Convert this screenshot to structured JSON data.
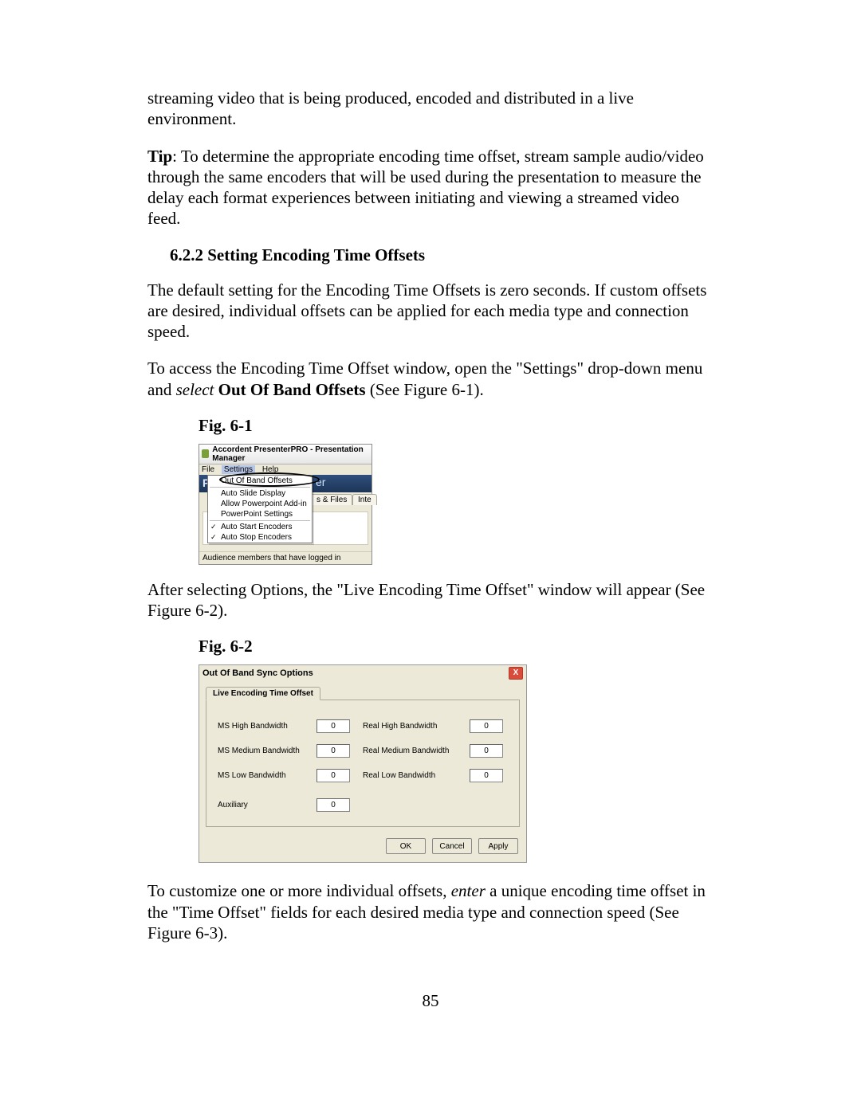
{
  "para1": "streaming video that is being produced, encoded and distributed in a live environment.",
  "tip_label": "Tip",
  "tip_body": ":  To determine the appropriate encoding time offset, stream sample audio/video through the same encoders that will be used during the presentation to measure the delay each format experiences between initiating and viewing a streamed video feed.",
  "heading": "6.2.2  Setting Encoding Time Offsets",
  "para2": "The default setting for the Encoding Time Offsets is zero seconds.  If custom offsets are desired, individual offsets can be applied for each media type and connection speed.",
  "para3a": "To access the Encoding Time Offset window, open the \"Settings\" drop-down menu and ",
  "para3_select": "select",
  "para3_bold": " Out Of Band Offsets",
  "para3b": " (See Figure 6-1).",
  "fig61_cap": "Fig. 6-1",
  "fig61": {
    "title": "Accordent PresenterPRO  - Presentation Manager",
    "menu_file": "File",
    "menu_settings": "Settings",
    "menu_help": "Help",
    "brand_pr": "Pr",
    "brand_er": "er",
    "dropdown": {
      "oob": "Out Of Band Offsets",
      "auto_slide": "Auto Slide Display",
      "allow_addin": "Allow Powerpoint Add-in",
      "ppt_settings": "PowerPoint Settings",
      "auto_start": "Auto Start Encoders",
      "auto_stop": "Auto Stop Encoders"
    },
    "tab_files": "s & Files",
    "tab_inte": "Inte",
    "audience": "Audience members that have logged in"
  },
  "para4": "After selecting Options, the \"Live Encoding Time Offset\" window will appear (See Figure 6-2).",
  "fig62_cap": "Fig. 6-2",
  "fig62": {
    "title": "Out Of Band Sync Options",
    "tab": "Live Encoding Time Offset",
    "labels": {
      "ms_high": "MS High Bandwidth",
      "ms_med": "MS Medium Bandwidth",
      "ms_low": "MS Low Bandwidth",
      "real_high": "Real High Bandwidth",
      "real_med": "Real Medium Bandwidth",
      "real_low": "Real Low Bandwidth",
      "aux": "Auxiliary"
    },
    "values": {
      "ms_high": "0",
      "ms_med": "0",
      "ms_low": "0",
      "real_high": "0",
      "real_med": "0",
      "real_low": "0",
      "aux": "0"
    },
    "buttons": {
      "ok": "OK",
      "cancel": "Cancel",
      "apply": "Apply"
    }
  },
  "para5a": "To customize one or more individual offsets, ",
  "para5_enter": "enter",
  "para5b": " a unique encoding time offset in the \"Time Offset\" fields for each desired media type and connection speed (See Figure 6-3).",
  "page_number": "85"
}
